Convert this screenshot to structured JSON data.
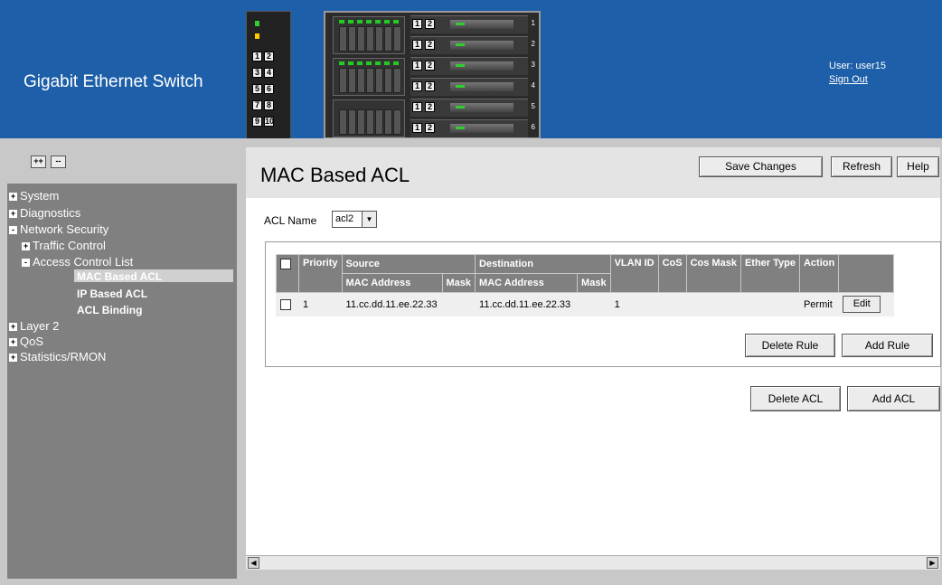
{
  "header": {
    "app_title": "Gigabit Ethernet Switch",
    "user_label": "User: user15",
    "sign_out": "Sign Out",
    "device": {
      "left_ports": [
        "1",
        "2",
        "3",
        "4",
        "5",
        "6",
        "7",
        "8",
        "9",
        "10"
      ],
      "blade_numbers": [
        "1",
        "2",
        "3",
        "4",
        "5",
        "6"
      ],
      "blade_port_labels": [
        "1",
        "2"
      ]
    }
  },
  "sidebar": {
    "expand_all": "++",
    "collapse_all": "--",
    "items": [
      {
        "label": "System",
        "marker": "+"
      },
      {
        "label": "Diagnostics",
        "marker": "+"
      },
      {
        "label": "Network Security",
        "marker": "-"
      },
      {
        "label": "Traffic Control",
        "marker": "+"
      },
      {
        "label": "Access Control List",
        "marker": "-"
      },
      {
        "label": "MAC Based ACL",
        "marker": ""
      },
      {
        "label": "IP Based ACL",
        "marker": ""
      },
      {
        "label": "ACL Binding",
        "marker": ""
      },
      {
        "label": "Layer 2",
        "marker": "+"
      },
      {
        "label": "QoS",
        "marker": "+"
      },
      {
        "label": "Statistics/RMON",
        "marker": "+"
      }
    ]
  },
  "main": {
    "page_title": "MAC Based ACL",
    "toolbar": {
      "save_changes": "Save Changes",
      "refresh": "Refresh",
      "help": "Help"
    },
    "acl_name_label": "ACL Name",
    "acl_name_value": "acl2",
    "table": {
      "headers": {
        "priority": "Priority",
        "source": "Source",
        "destination": "Destination",
        "vlan_id": "VLAN ID",
        "cos": "CoS",
        "cos_mask": "Cos Mask",
        "ether_type": "Ether Type",
        "action": "Action",
        "mac_address": "MAC Address",
        "mask": "Mask"
      },
      "rows": [
        {
          "priority": "1",
          "source_mac": "11.cc.dd.11.ee.22.33",
          "source_mask": "",
          "dest_mac": "11.cc.dd.11.ee.22.33",
          "dest_mask": "",
          "vlan_id": "1",
          "cos": "",
          "cos_mask": "",
          "ether_type": "",
          "action": "Permit",
          "edit": "Edit"
        }
      ]
    },
    "delete_rule": "Delete Rule",
    "add_rule": "Add Rule",
    "delete_acl": "Delete ACL",
    "add_acl": "Add ACL"
  },
  "colors": {
    "header_blue": "#1d5fa8",
    "nav_gray": "#808080",
    "table_header": "#808080"
  }
}
